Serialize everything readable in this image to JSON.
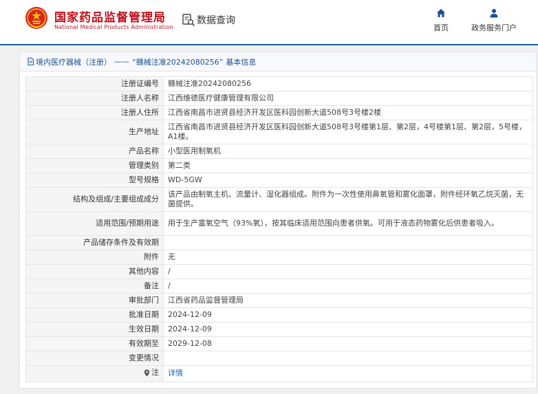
{
  "header": {
    "org_name": "国家药品监督管理局",
    "org_name_en": "National Medical Products Administration",
    "query_tab": "数据查询",
    "nav": [
      {
        "label": "首页",
        "icon": "home-icon"
      },
      {
        "label": "政务服务门户",
        "icon": "user-icon"
      }
    ],
    "brand_color": "#c0101b",
    "accent_color": "#1e5aa8"
  },
  "panel": {
    "title_category": "境内医疗器械（注册）",
    "title_sep": "——",
    "title_record": "“赣械注准20242080256”",
    "title_suffix": "基本信息"
  },
  "table": {
    "rows": [
      {
        "label": "注册证编号",
        "value": "赣械注准20242080256"
      },
      {
        "label": "注册人名称",
        "value": "江西维德医疗健康管理有限公司"
      },
      {
        "label": "注册人住所",
        "value": "江西省南昌市进贤县经济开发区医科园创新大道508号3号楼2楼"
      },
      {
        "label": "生产地址",
        "value": "江西省南昌市进贤县经济开发区医科园创新大道508号3号楼第1层、第2层，4号楼第1层、第2层，5号楼，A1楼。"
      },
      {
        "label": "产品名称",
        "value": "小型医用制氧机"
      },
      {
        "label": "管理类别",
        "value": "第二类"
      },
      {
        "label": "型号规格",
        "value": "WD-5GW"
      },
      {
        "label": "结构及组成/主要组成成分",
        "value": "该产品由制氧主机、流量计、湿化器组成。附件为一次性使用鼻氧管和雾化面罩，附件经环氧乙烷灭菌，无菌提供。"
      },
      {
        "label": "适用范围/预期用途",
        "value": "用于生产富氧空气（93%氧），按其临床适用范围向患者供氧。可用于液态药物雾化后供患者吸入。"
      },
      {
        "label": "产品储存条件及有效期",
        "value": ""
      },
      {
        "label": "附件",
        "value": "无"
      },
      {
        "label": "其他内容",
        "value": "/"
      },
      {
        "label": "备注",
        "value": "/"
      },
      {
        "label": "审批部门",
        "value": "江西省药品监督管理局"
      },
      {
        "label": "批准日期",
        "value": "2024-12-09"
      },
      {
        "label": "生效日期",
        "value": "2024-12-09"
      },
      {
        "label": "有效期至",
        "value": "2029-12-08"
      },
      {
        "label": "变更情况",
        "value": ""
      }
    ],
    "note_row": {
      "label": "注",
      "link_text": "详情",
      "icon": "map-pin-icon"
    }
  }
}
